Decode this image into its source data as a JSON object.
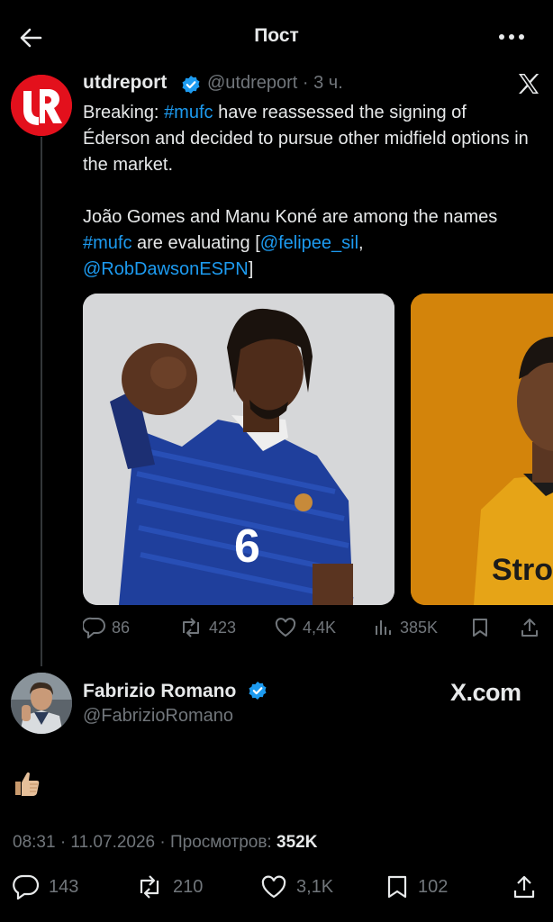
{
  "header": {
    "title": "Пост"
  },
  "quoted": {
    "name": "utdreport",
    "handle_time": "@utdreport · 3 ч.",
    "text_p1_a": "Breaking: ",
    "text_p1_tag": "#mufc",
    "text_p1_b": " have reassessed the signing of Éderson and decided to pursue other midfield options in the market.",
    "text_p2_a": "João Gomes and Manu Koné are among the names ",
    "text_p2_tag": "#mufc",
    "text_p2_b": " are evaluating [",
    "text_p2_m1": "@felipee_sil",
    "text_p2_c": ", ",
    "text_p2_m2": "@RobDawsonESPN",
    "text_p2_d": "]",
    "actions": {
      "replies": "86",
      "reposts": "423",
      "likes": "4,4K",
      "views": "385K"
    }
  },
  "author": {
    "name": "Fabrizio Romano",
    "handle": "@FabrizioRomano",
    "watermark": "X.com",
    "body_emoji": "thumbs-up"
  },
  "meta": {
    "time_date": "08:31 · 11.07.2026 · ",
    "views_label": "Просмотров: ",
    "views_value": "352K"
  },
  "actions": {
    "replies": "143",
    "reposts": "210",
    "likes": "3,1K",
    "bookmarks": "102"
  },
  "colors": {
    "background": "#000000",
    "link": "#1d9bf0",
    "muted": "#71767b",
    "verified": "#1d9bf0",
    "utdreport_red": "#e3101c"
  }
}
